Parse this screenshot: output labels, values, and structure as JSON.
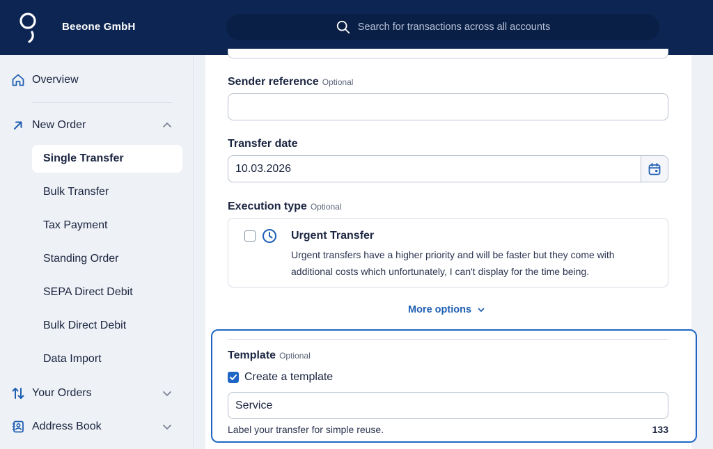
{
  "header": {
    "company": "Beeone GmbH",
    "search_placeholder": "Search for transactions across all accounts"
  },
  "sidebar": {
    "overview": "Overview",
    "new_order": "New Order",
    "sub_items": [
      "Single Transfer",
      "Bulk Transfer",
      "Tax Payment",
      "Standing Order",
      "SEPA Direct Debit",
      "Bulk Direct Debit",
      "Data Import"
    ],
    "active_sub_item": "Single Transfer",
    "your_orders": "Your Orders",
    "address_book": "Address Book"
  },
  "form": {
    "optional": "Optional",
    "sender_reference": {
      "label": "Sender reference",
      "value": ""
    },
    "transfer_date": {
      "label": "Transfer date",
      "value": "10.03.2026"
    },
    "execution_type": {
      "label": "Execution type",
      "urgent_title": "Urgent Transfer",
      "urgent_description": "Urgent transfers have a higher priority and will be faster but they come with additional costs which unfortunately, I can't display for the time being.",
      "urgent_checked": false
    },
    "more_options": "More options",
    "template": {
      "label": "Template",
      "create_label": "Create a template",
      "create_checked": true,
      "value": "Service",
      "hint": "Label your transfer for simple reuse.",
      "counter": "133"
    }
  },
  "colors": {
    "header_bg": "#0d2552",
    "accent": "#1f66c4",
    "link": "#1f5fb3"
  }
}
